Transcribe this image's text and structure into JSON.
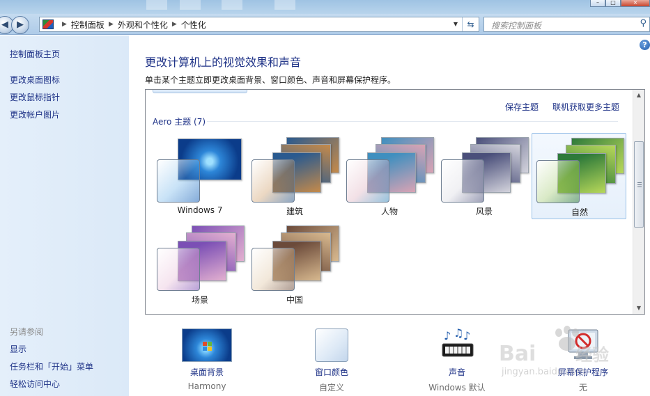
{
  "breadcrumb": [
    "控制面板",
    "外观和个性化",
    "个性化"
  ],
  "search": {
    "placeholder": "搜索控制面板"
  },
  "help_glyph": "?",
  "sidebar": {
    "home": "控制面板主页",
    "tasks": [
      "更改桌面图标",
      "更改鼠标指针",
      "更改帐户图片"
    ],
    "see_also_header": "另请参阅",
    "see_also": [
      "显示",
      "任务栏和「开始」菜单",
      "轻松访问中心"
    ]
  },
  "main": {
    "title": "更改计算机上的视觉效果和声音",
    "description": "单击某个主题立即更改桌面背景、窗口颜色、声音和屏幕保护程序。"
  },
  "panel": {
    "save_theme": "保存主题",
    "get_more_themes": "联机获取更多主题",
    "group_label": "Aero 主题 (7)"
  },
  "themes": [
    {
      "name": "Windows 7",
      "selected": false,
      "colors": [
        "#1a62b8",
        "#5aa9e6"
      ]
    },
    {
      "name": "建筑",
      "selected": false,
      "colors": [
        "#2a5a8f",
        "#c58a4a"
      ]
    },
    {
      "name": "人物",
      "selected": false,
      "colors": [
        "#3f8fbf",
        "#d9a3b4"
      ]
    },
    {
      "name": "风景",
      "selected": false,
      "colors": [
        "#4a4f7a",
        "#d3d3dc"
      ]
    },
    {
      "name": "自然",
      "selected": true,
      "colors": [
        "#2e7a3a",
        "#b8d85a"
      ]
    },
    {
      "name": "场景",
      "selected": false,
      "colors": [
        "#7b4fb5",
        "#e3b0d0"
      ]
    },
    {
      "name": "中国",
      "selected": false,
      "colors": [
        "#6b4a3a",
        "#d8b98f"
      ]
    }
  ],
  "settings": [
    {
      "label": "桌面背景",
      "value": "Harmony",
      "icon": "desktop-background-icon"
    },
    {
      "label": "窗口颜色",
      "value": "自定义",
      "icon": "window-color-icon"
    },
    {
      "label": "声音",
      "value": "Windows 默认",
      "icon": "sound-icon"
    },
    {
      "label": "屏幕保护程序",
      "value": "无",
      "icon": "screensaver-icon"
    }
  ],
  "watermark": {
    "text": "Baidu经验",
    "url": "jingyan.baidu.com"
  }
}
